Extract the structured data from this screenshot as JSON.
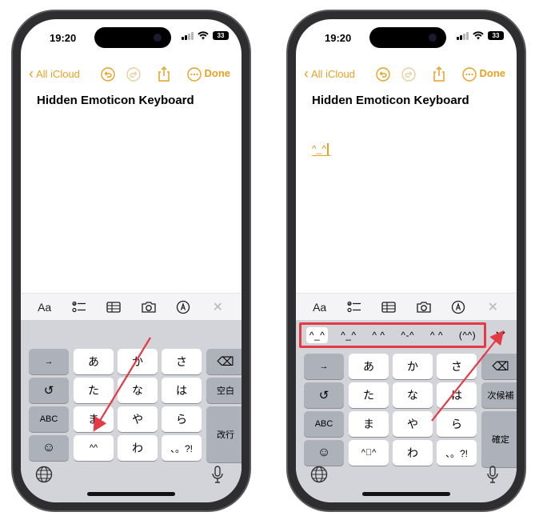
{
  "left_phone": {
    "status": {
      "time": "19:20",
      "battery": "33"
    },
    "nav": {
      "back_label": "All iCloud",
      "done_label": "Done"
    },
    "note": {
      "title": "Hidden Emoticon Keyboard",
      "body": ""
    },
    "toolbar": {
      "format_label": "Aa"
    },
    "keyboard": {
      "rows": [
        {
          "left": "→",
          "keys": [
            "あ",
            "か",
            "さ"
          ],
          "right": "⌫"
        },
        {
          "left": "↺",
          "keys": [
            "た",
            "な",
            "は"
          ],
          "right": "空白"
        },
        {
          "left": "ABC",
          "keys": [
            "ま",
            "や",
            "ら"
          ],
          "right": "改行"
        },
        {
          "left": "☺",
          "keys": [
            "^^",
            "わ",
            "、。?!"
          ]
        }
      ]
    }
  },
  "right_phone": {
    "status": {
      "time": "19:20",
      "battery": "33"
    },
    "nav": {
      "back_label": "All iCloud",
      "done_label": "Done"
    },
    "note": {
      "title": "Hidden Emoticon Keyboard",
      "body": "^_^"
    },
    "toolbar": {
      "format_label": "Aa"
    },
    "candidates": [
      "^_^",
      "^_^",
      "^ ^",
      "^-^",
      "^ ^",
      "(^^)"
    ],
    "keyboard": {
      "rows": [
        {
          "left": "→",
          "keys": [
            "あ",
            "か",
            "さ"
          ],
          "right": "⌫"
        },
        {
          "left": "↺",
          "keys": [
            "た",
            "な",
            "は"
          ],
          "right": "次候補"
        },
        {
          "left": "ABC",
          "keys": [
            "ま",
            "や",
            "ら"
          ],
          "right": "確定"
        },
        {
          "left": "☺",
          "keys": [
            "^ﾟ^",
            "わ",
            "、。?!"
          ]
        }
      ]
    }
  },
  "colors": {
    "accent": "#e6a224",
    "annotation_red": "#e33a43"
  }
}
